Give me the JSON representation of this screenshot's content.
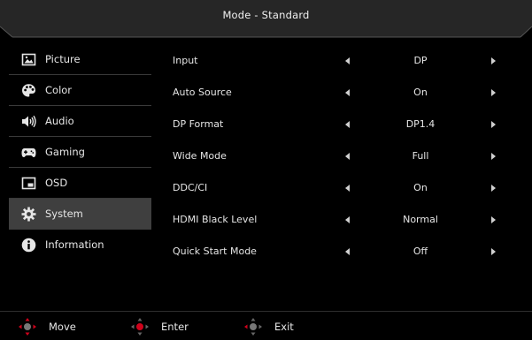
{
  "header": {
    "title": "Mode - Standard"
  },
  "sidebar": {
    "items": [
      {
        "label": "Picture",
        "icon": "picture-icon",
        "selected": false
      },
      {
        "label": "Color",
        "icon": "palette-icon",
        "selected": false
      },
      {
        "label": "Audio",
        "icon": "speaker-icon",
        "selected": false
      },
      {
        "label": "Gaming",
        "icon": "gamepad-icon",
        "selected": false
      },
      {
        "label": "OSD",
        "icon": "osd-window-icon",
        "selected": false
      },
      {
        "label": "System",
        "icon": "gear-icon",
        "selected": true
      },
      {
        "label": "Information",
        "icon": "info-icon",
        "selected": false
      }
    ]
  },
  "settings": [
    {
      "name": "Input",
      "value": "DP"
    },
    {
      "name": "Auto Source",
      "value": "On"
    },
    {
      "name": "DP Format",
      "value": "DP1.4"
    },
    {
      "name": "Wide Mode",
      "value": "Full"
    },
    {
      "name": "DDC/CI",
      "value": "On"
    },
    {
      "name": "HDMI Black Level",
      "value": "Normal"
    },
    {
      "name": "Quick Start Mode",
      "value": "Off"
    }
  ],
  "footer": {
    "move_label": "Move",
    "enter_label": "Enter",
    "exit_label": "Exit"
  },
  "colors": {
    "background": "#000000",
    "selected_item": "#3f3f3f",
    "header_tab": "#262626",
    "joystick_accent": "#d0021b",
    "text": "#e6e6e6"
  }
}
